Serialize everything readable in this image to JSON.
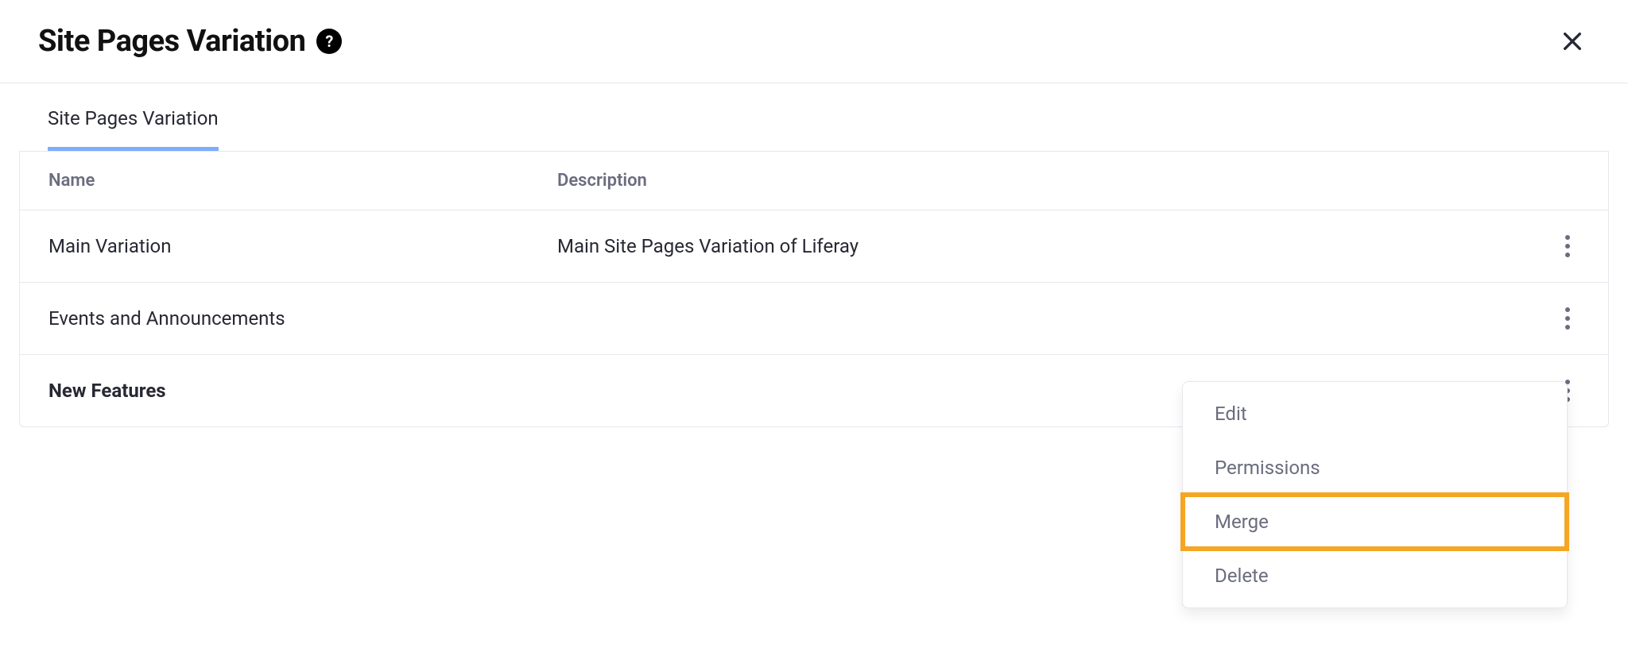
{
  "header": {
    "title": "Site Pages Variation",
    "help_label": "?"
  },
  "tabs": {
    "active": "Site Pages Variation"
  },
  "table": {
    "columns": {
      "name": "Name",
      "description": "Description"
    },
    "rows": [
      {
        "name": "Main Variation",
        "description": "Main Site Pages Variation of Liferay",
        "bold": false
      },
      {
        "name": "Events and Announcements",
        "description": "",
        "bold": false
      },
      {
        "name": "New Features",
        "description": "",
        "bold": true
      }
    ]
  },
  "dropdown": {
    "items": [
      {
        "label": "Edit",
        "highlighted": false
      },
      {
        "label": "Permissions",
        "highlighted": false
      },
      {
        "label": "Merge",
        "highlighted": true
      },
      {
        "label": "Delete",
        "highlighted": false
      }
    ]
  }
}
